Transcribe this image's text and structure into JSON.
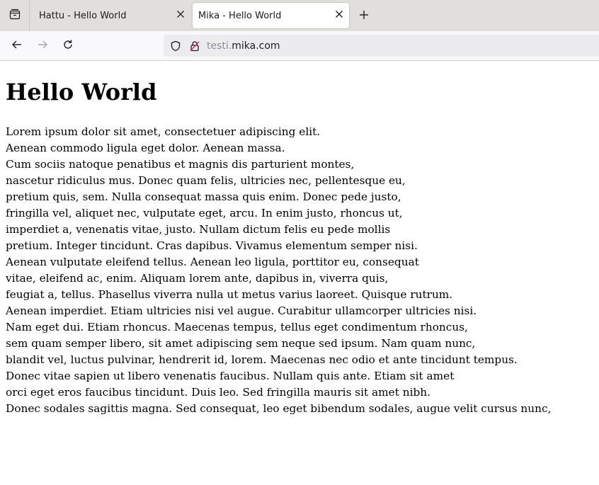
{
  "browser": {
    "tabs": [
      {
        "title": "Hattu - Hello World",
        "active": false
      },
      {
        "title": "Mika - Hello World",
        "active": true
      }
    ],
    "url": {
      "subdomain": "testi.",
      "domain": "mika.com"
    }
  },
  "page": {
    "heading": "Hello World",
    "paragraph_lines": [
      "Lorem ipsum dolor sit amet, consectetuer adipiscing elit.",
      "Aenean commodo ligula eget dolor. Aenean massa.",
      "Cum sociis natoque penatibus et magnis dis parturient montes,",
      "nascetur ridiculus mus. Donec quam felis, ultricies nec, pellentesque eu,",
      "pretium quis, sem. Nulla consequat massa quis enim. Donec pede justo,",
      "fringilla vel, aliquet nec, vulputate eget, arcu. In enim justo, rhoncus ut,",
      "imperdiet a, venenatis vitae, justo. Nullam dictum felis eu pede mollis",
      "pretium. Integer tincidunt. Cras dapibus. Vivamus elementum semper nisi.",
      "Aenean vulputate eleifend tellus. Aenean leo ligula, porttitor eu, consequat",
      "vitae, eleifend ac, enim. Aliquam lorem ante, dapibus in, viverra quis,",
      "feugiat a, tellus. Phasellus viverra nulla ut metus varius laoreet. Quisque rutrum.",
      "Aenean imperdiet. Etiam ultricies nisi vel augue. Curabitur ullamcorper ultricies nisi.",
      "Nam eget dui. Etiam rhoncus. Maecenas tempus, tellus eget condimentum rhoncus,",
      "sem quam semper libero, sit amet adipiscing sem neque sed ipsum. Nam quam nunc,",
      "blandit vel, luctus pulvinar, hendrerit id, lorem. Maecenas nec odio et ante tincidunt tempus.",
      "Donec vitae sapien ut libero venenatis faucibus. Nullam quis ante. Etiam sit amet",
      "orci eget eros faucibus tincidunt. Duis leo. Sed fringilla mauris sit amet nibh.",
      "Donec sodales sagittis magna. Sed consequat, leo eget bibendum sodales, augue velit cursus nunc,"
    ]
  },
  "icons": {
    "tab_list": "tab-list-icon",
    "tab_close": "close-icon",
    "new_tab": "plus-icon",
    "back": "back-arrow-icon",
    "forward": "forward-arrow-icon",
    "reload": "reload-icon",
    "tracking_protection": "shield-icon",
    "insecure_connection": "insecure-lock-icon"
  },
  "colors": {
    "tabstrip_bg": "#e0dfdb",
    "toolbar_bg": "#f9f9fb",
    "urlbar_bg": "#ececef",
    "url_subdomain": "#8f8f9d",
    "insecure_lock": "#e22850"
  }
}
